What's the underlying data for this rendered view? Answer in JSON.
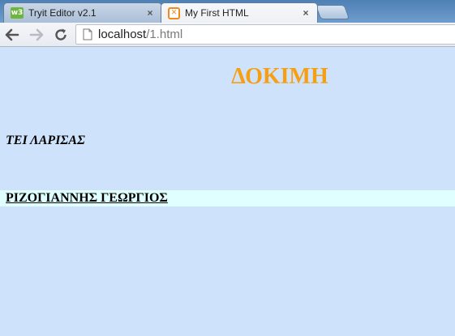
{
  "browser": {
    "tabs": [
      {
        "title": "Tryit Editor v2.1",
        "icon": "w3schools-icon",
        "active": false,
        "close": "×"
      },
      {
        "title": "My First HTML",
        "icon": "xampp-icon",
        "active": true,
        "close": "×"
      }
    ],
    "url": {
      "host": "localhost",
      "path": "/1.html"
    }
  },
  "page": {
    "heading": "ΔΟΚΙΜΗ",
    "school": "ΤΕΙ ΛΑΡΙΣΑΣ",
    "name": "ΡΙΖΟΓΙΑΝΝΗΣ ΓΕΩΡΓΙΟΣ"
  },
  "colors": {
    "page_background": "#cfe2fc",
    "heading": "#f5a014",
    "name_highlight": "#e0ffff"
  }
}
